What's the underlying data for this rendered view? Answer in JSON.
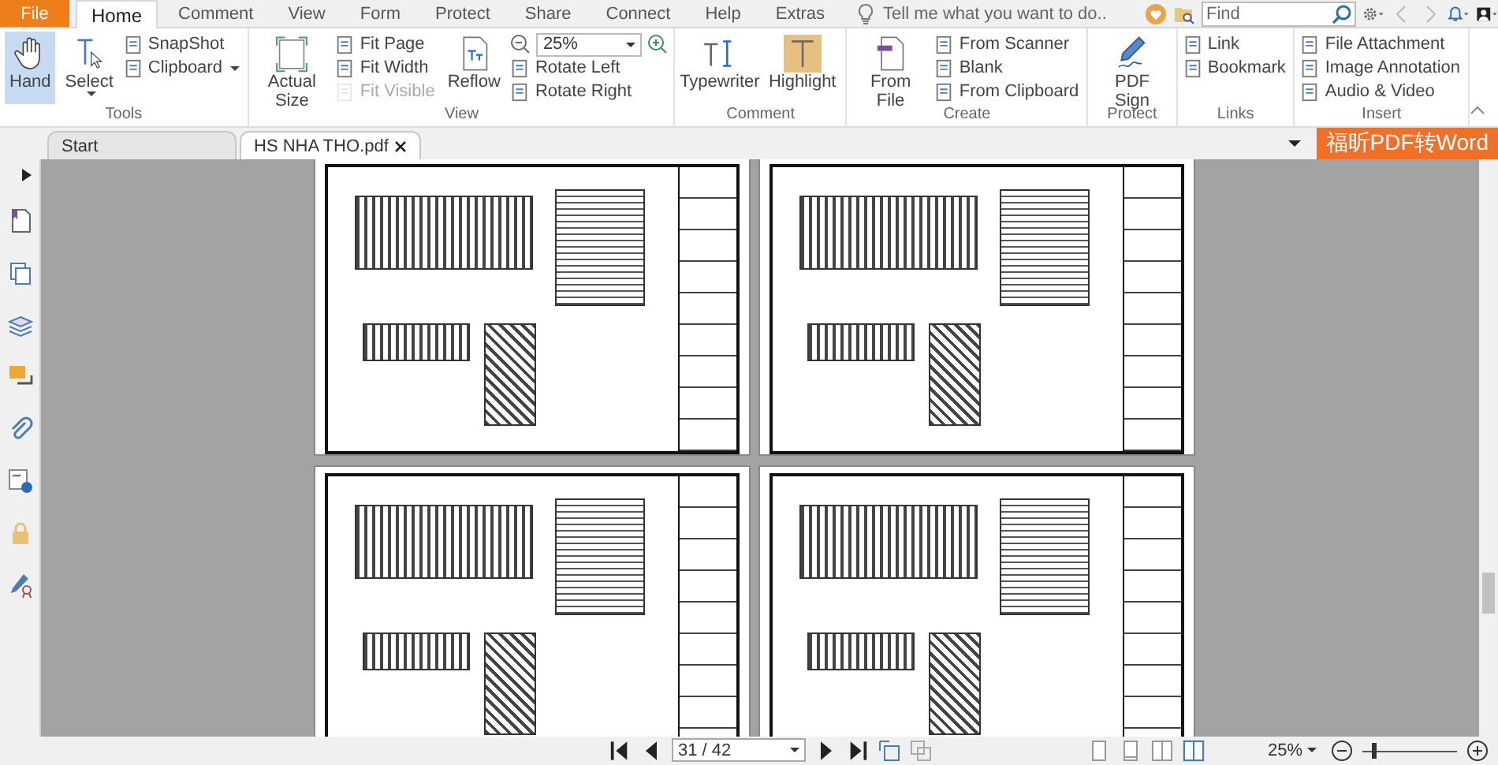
{
  "menu_tabs": [
    {
      "label": "File",
      "kind": "file",
      "selected": false
    },
    {
      "label": "Home",
      "kind": "tab",
      "selected": true
    },
    {
      "label": "Comment",
      "kind": "tab",
      "selected": false
    },
    {
      "label": "View",
      "kind": "tab",
      "selected": false
    },
    {
      "label": "Form",
      "kind": "tab",
      "selected": false
    },
    {
      "label": "Protect",
      "kind": "tab",
      "selected": false
    },
    {
      "label": "Share",
      "kind": "tab",
      "selected": false
    },
    {
      "label": "Connect",
      "kind": "tab",
      "selected": false
    },
    {
      "label": "Help",
      "kind": "tab",
      "selected": false
    },
    {
      "label": "Extras",
      "kind": "tab",
      "selected": false
    }
  ],
  "tell_me": {
    "placeholder": "Tell me what you want to do.."
  },
  "find": {
    "placeholder": "Find"
  },
  "ribbon": [
    {
      "name": "Tools",
      "columns": [
        [
          {
            "kind": "large",
            "label": "Hand",
            "active": true,
            "disabled": false
          }
        ],
        [
          {
            "kind": "large",
            "label": "Select",
            "active": false,
            "disabled": false,
            "dropdown": true
          }
        ],
        [
          {
            "kind": "small",
            "label": "SnapShot",
            "active": false,
            "disabled": false
          },
          {
            "kind": "small",
            "label": "Clipboard",
            "active": false,
            "disabled": false,
            "dropdown": true
          }
        ]
      ]
    },
    {
      "name": "View",
      "columns": [
        [
          {
            "kind": "large",
            "label": "Actual Size",
            "active": false,
            "disabled": false
          }
        ],
        [
          {
            "kind": "small",
            "label": "Fit Page",
            "active": false,
            "disabled": false
          },
          {
            "kind": "small",
            "label": "Fit Width",
            "active": false,
            "disabled": false
          },
          {
            "kind": "small",
            "label": "Fit Visible",
            "active": false,
            "disabled": true
          }
        ],
        [
          {
            "kind": "large",
            "label": "Reflow",
            "active": false,
            "disabled": false
          }
        ],
        [
          {
            "kind": "combo",
            "value": "25%"
          },
          {
            "kind": "small",
            "label": "Rotate Left",
            "active": false,
            "disabled": false
          },
          {
            "kind": "small",
            "label": "Rotate Right",
            "active": false,
            "disabled": false
          }
        ]
      ]
    },
    {
      "name": "Comment",
      "columns": [
        [
          {
            "kind": "large",
            "label": "Typewriter",
            "active": false,
            "disabled": false
          }
        ],
        [
          {
            "kind": "large",
            "label": "Highlight",
            "active": false,
            "disabled": false
          }
        ]
      ]
    },
    {
      "name": "Create",
      "columns": [
        [
          {
            "kind": "large",
            "label": "From File",
            "active": false,
            "disabled": false
          }
        ],
        [
          {
            "kind": "small",
            "label": "From Scanner",
            "active": false,
            "disabled": false
          },
          {
            "kind": "small",
            "label": "Blank",
            "active": false,
            "disabled": false
          },
          {
            "kind": "small",
            "label": "From Clipboard",
            "active": false,
            "disabled": false
          }
        ]
      ]
    },
    {
      "name": "Protect",
      "columns": [
        [
          {
            "kind": "large",
            "label": "PDF Sign",
            "active": false,
            "disabled": false
          }
        ]
      ]
    },
    {
      "name": "Links",
      "columns": [
        [
          {
            "kind": "small",
            "label": "Link",
            "active": false,
            "disabled": false
          },
          {
            "kind": "small",
            "label": "Bookmark",
            "active": false,
            "disabled": false
          }
        ]
      ]
    },
    {
      "name": "Insert",
      "columns": [
        [
          {
            "kind": "small",
            "label": "File Attachment",
            "active": false,
            "disabled": false
          },
          {
            "kind": "small",
            "label": "Image Annotation",
            "active": false,
            "disabled": false
          },
          {
            "kind": "small",
            "label": "Audio & Video",
            "active": false,
            "disabled": false
          }
        ]
      ]
    }
  ],
  "doc_tabs": [
    {
      "label": "Start",
      "selected": false,
      "closable": false
    },
    {
      "label": "HS NHA THO.pdf",
      "selected": true,
      "closable": true
    }
  ],
  "convert_button": {
    "label": "福昕PDF转Word"
  },
  "status_bar": {
    "page_field": "31 / 42",
    "zoom": "25%",
    "zoom_slider": {
      "level": 0.12
    }
  }
}
